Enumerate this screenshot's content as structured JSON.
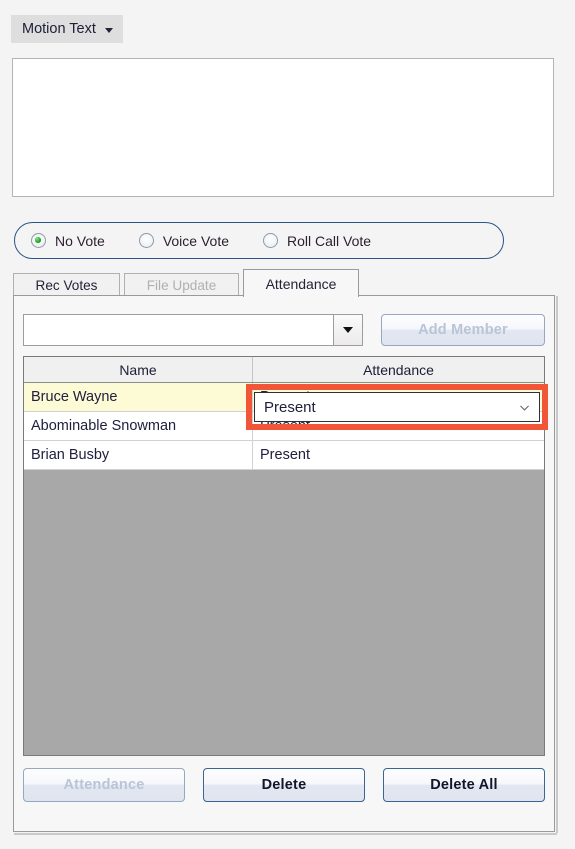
{
  "toolbar": {
    "motion_text_label": "Motion Text",
    "caret_icon": "caret-down-icon"
  },
  "memo": {
    "value": "",
    "placeholder": ""
  },
  "vote_group": {
    "options": [
      {
        "label": "No Vote",
        "checked": true
      },
      {
        "label": "Voice Vote",
        "checked": false
      },
      {
        "label": "Roll Call Vote",
        "checked": false
      }
    ],
    "border_color": "#2a5584",
    "selected_dot_color": "#26a426"
  },
  "tabs": [
    {
      "label": "Rec Votes",
      "state": "enabled"
    },
    {
      "label": "File Update",
      "state": "disabled"
    },
    {
      "label": "Attendance",
      "state": "active"
    }
  ],
  "filter_row": {
    "member_combo": {
      "value": "",
      "placeholder": "",
      "arrow_icon": "triangle-down-icon"
    },
    "add_member_label": "Add Member",
    "add_member_state": "disabled"
  },
  "grid": {
    "columns": [
      "Name",
      "Attendance"
    ],
    "rows": [
      {
        "name": "Bruce Wayne",
        "attendance": "Present",
        "selected": true
      },
      {
        "name": "Abominable Snowman",
        "attendance": "Present",
        "selected": false
      },
      {
        "name": "Brian Busby",
        "attendance": "Present",
        "selected": false
      }
    ],
    "empty_area_color": "#a8a8a8",
    "selected_row_color": "#fdfbd5"
  },
  "cell_editor": {
    "value": "Present",
    "chevron_icon": "chevron-down-icon",
    "highlight_color": "#f25639"
  },
  "footer_buttons": [
    {
      "label": "Attendance",
      "state": "disabled"
    },
    {
      "label": "Delete",
      "state": "enabled"
    },
    {
      "label": "Delete All",
      "state": "enabled"
    }
  ]
}
